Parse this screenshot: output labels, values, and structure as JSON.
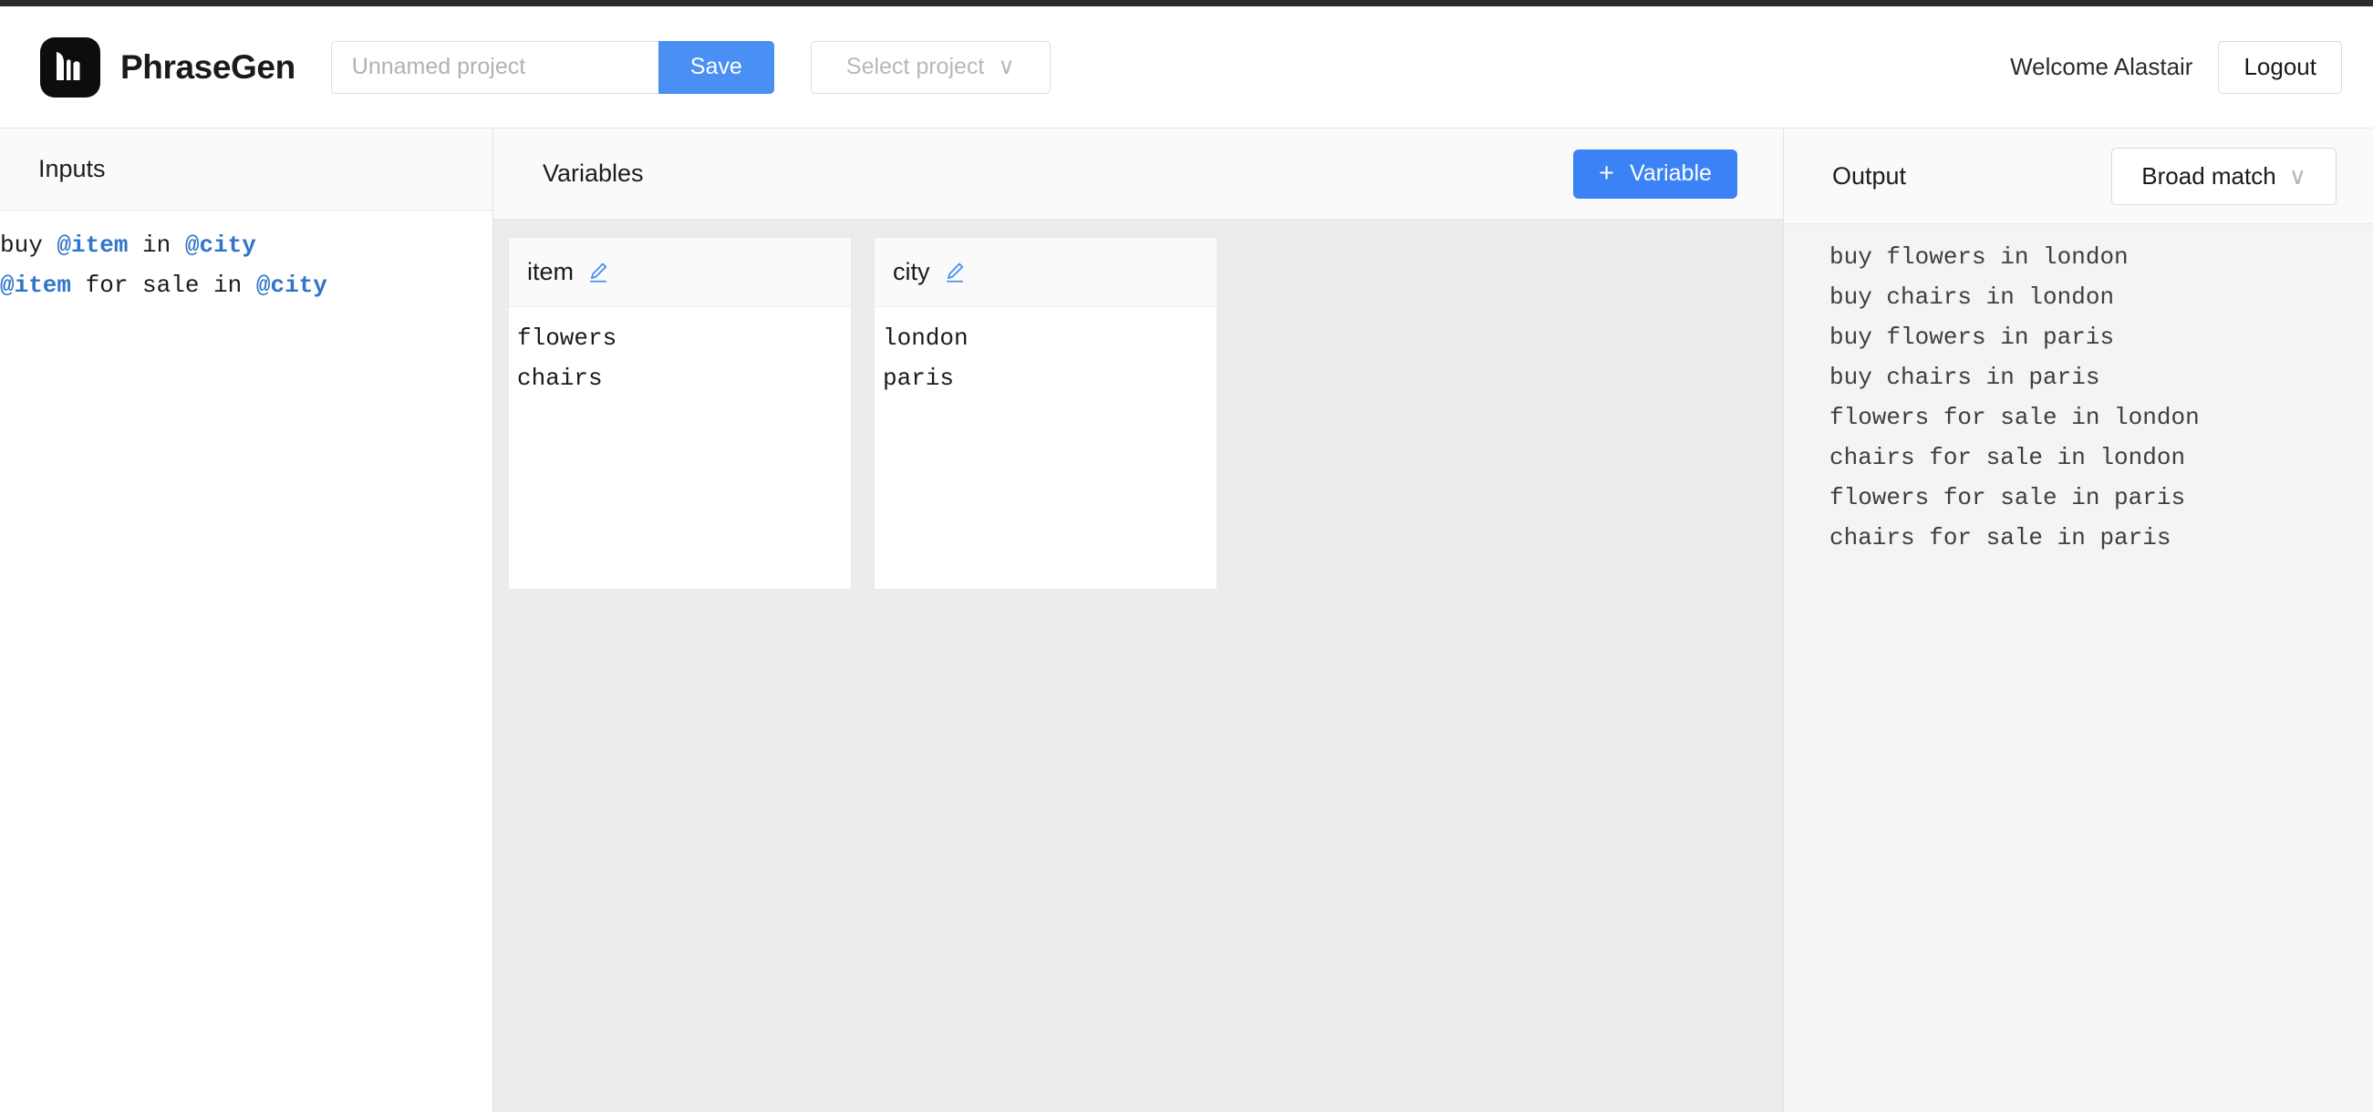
{
  "header": {
    "brand_name": "PhraseGen",
    "logo_icon": "phrasegen-logo-icon",
    "project_name_value": "",
    "project_name_placeholder": "Unnamed project",
    "save_label": "Save",
    "select_project_label": "Select project",
    "select_project_chevron": "∨",
    "welcome_text": "Welcome Alastair",
    "logout_label": "Logout"
  },
  "inputs_panel": {
    "title": "Inputs",
    "lines": [
      [
        {
          "text": "buy ",
          "type": "plain"
        },
        {
          "text": "@item",
          "type": "variable"
        },
        {
          "text": " in ",
          "type": "plain"
        },
        {
          "text": "@city",
          "type": "variable"
        }
      ],
      [
        {
          "text": "@item",
          "type": "variable"
        },
        {
          "text": " for sale in ",
          "type": "plain"
        },
        {
          "text": "@city",
          "type": "variable"
        }
      ]
    ]
  },
  "variables_panel": {
    "title": "Variables",
    "add_button_label": "Variable",
    "add_button_plus": "+",
    "cards": [
      {
        "name": "item",
        "edit_icon": "pencil-edit-icon",
        "values": [
          "flowers",
          "chairs"
        ]
      },
      {
        "name": "city",
        "edit_icon": "pencil-edit-icon",
        "values": [
          "london",
          "paris"
        ]
      }
    ]
  },
  "output_panel": {
    "title": "Output",
    "match_type_selected": "Broad match",
    "match_type_chevron": "∨",
    "lines": [
      "buy flowers in london",
      "buy chairs in london",
      "buy flowers in paris",
      "buy chairs in paris",
      "flowers for sale in london",
      "chairs for sale in london",
      "flowers for sale in paris",
      "chairs for sale in paris"
    ]
  },
  "colors": {
    "accent_blue": "#3b82f6",
    "save_blue": "#4a90f4",
    "variable_token_blue": "#3176c9",
    "panel_gray": "#ececec",
    "output_gray": "#f4f4f4",
    "header_gray": "#fafafa"
  }
}
